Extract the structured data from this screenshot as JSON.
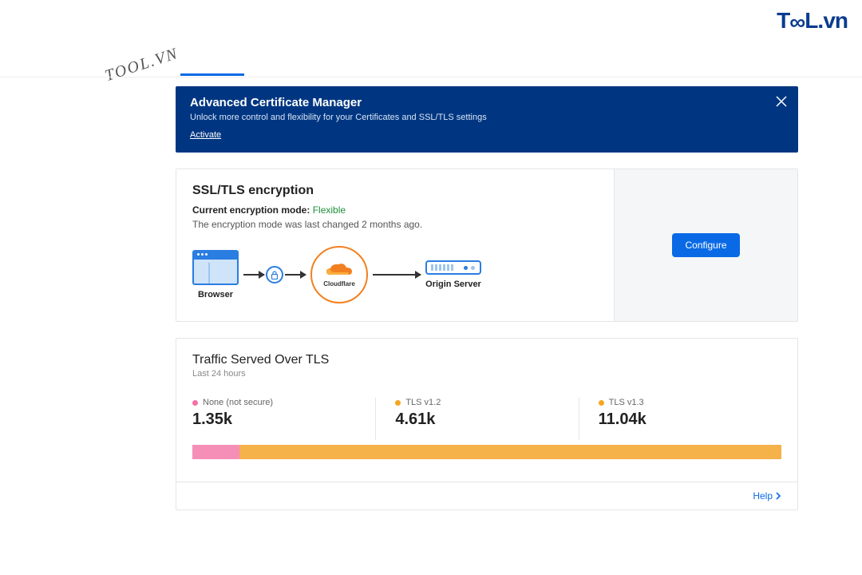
{
  "watermark": {
    "logo": "TooL.vn",
    "diag": "TOOL.VN"
  },
  "banner": {
    "title": "Advanced Certificate Manager",
    "desc": "Unlock more control and flexibility for your Certificates and SSL/TLS settings",
    "activate": "Activate"
  },
  "ssl": {
    "title": "SSL/TLS encryption",
    "mode_label": "Current encryption mode:",
    "mode_value": "Flexible",
    "mode_desc": "The encryption mode was last changed 2 months ago.",
    "browser_label": "Browser",
    "cf_label": "Cloudflare",
    "origin_label": "Origin Server",
    "configure": "Configure"
  },
  "traffic": {
    "title": "Traffic Served Over TLS",
    "subtitle": "Last 24 hours",
    "stats": [
      {
        "label": "None (not secure)",
        "value": "1.35k",
        "color": "pink"
      },
      {
        "label": "TLS v1.2",
        "value": "4.61k",
        "color": "orange"
      },
      {
        "label": "TLS v1.3",
        "value": "11.04k",
        "color": "orange"
      }
    ],
    "help": "Help"
  },
  "chart_data": {
    "type": "bar",
    "title": "Traffic Served Over TLS",
    "categories": [
      "None (not secure)",
      "TLS v1.2",
      "TLS v1.3"
    ],
    "values": [
      1350,
      4610,
      11040
    ],
    "colors": [
      "#f58fb8",
      "#f5b14a",
      "#f5b14a"
    ],
    "orientation": "horizontal-stacked",
    "xlabel": "",
    "ylabel": ""
  }
}
